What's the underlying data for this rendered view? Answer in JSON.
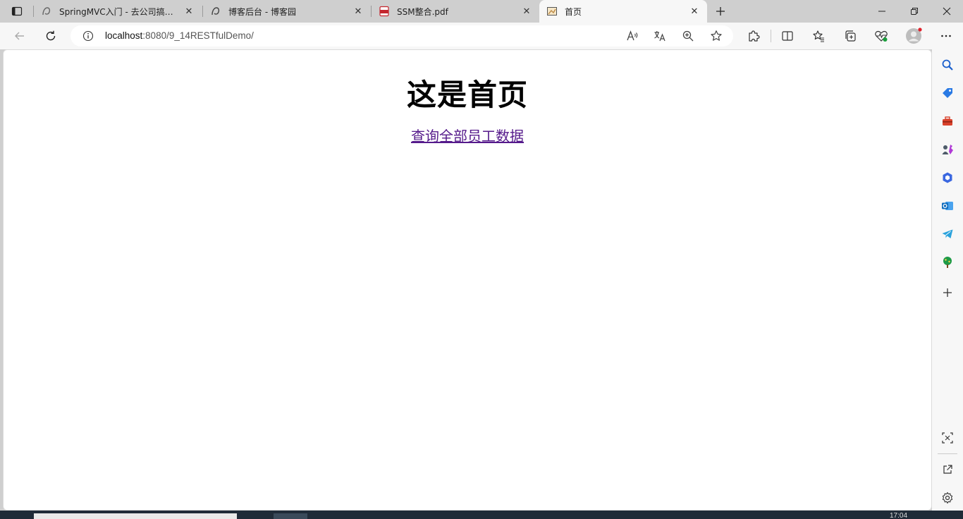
{
  "window": {
    "tabs": [
      {
        "title": "SpringMVC入门 - 去公司搞点薯条",
        "icon": "cnblogs-icon",
        "active": false
      },
      {
        "title": "博客后台 - 博客园",
        "icon": "cnblogs-icon",
        "active": false
      },
      {
        "title": "SSM整合.pdf",
        "icon": "pdf-icon",
        "active": false
      },
      {
        "title": "首页",
        "icon": "page-icon",
        "active": true
      }
    ],
    "controls": [
      "minimize",
      "restore",
      "close"
    ]
  },
  "toolbar": {
    "address": {
      "host": "localhost",
      "rest": ":8080/9_14RESTfulDemo/"
    }
  },
  "page": {
    "heading": "这是首页",
    "link_text": "查询全部员工数据"
  },
  "sidebar": {
    "items": [
      "search-icon",
      "shopping-tag-icon",
      "toolbox-icon",
      "games-icon",
      "office-icon",
      "outlook-icon",
      "telegram-icon",
      "tree-icon",
      "add-icon"
    ],
    "bottom": [
      "screenshot-icon",
      "open-external-icon",
      "settings-icon"
    ]
  },
  "taskbar": {
    "clock": "17:04"
  },
  "colors": {
    "link_visited": "#551a8b",
    "chrome_bg": "#cfcfcf",
    "toolbar_bg": "#f7f7f7",
    "profile_badge": "#e0202a"
  }
}
